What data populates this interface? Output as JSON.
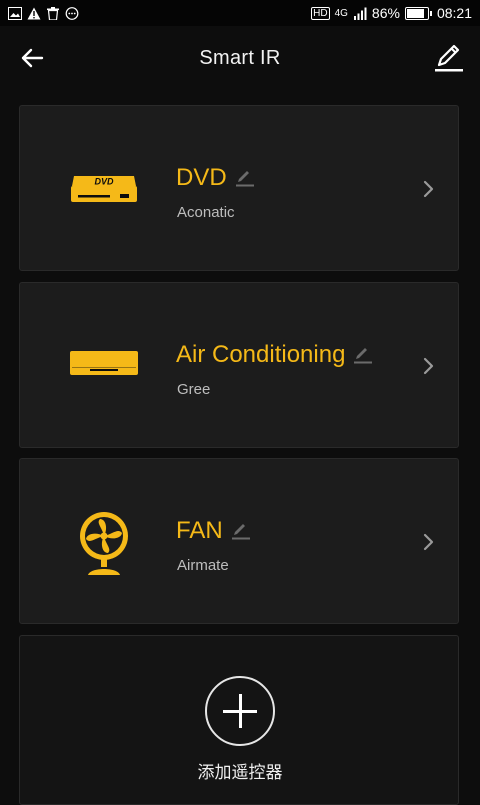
{
  "status_bar": {
    "battery": "86%",
    "time": "08:21",
    "network": "4G",
    "hd": "HD",
    "battery_level": 0.86
  },
  "header": {
    "title": "Smart IR",
    "back_icon": "arrow-left-icon",
    "edit_icon": "pencil-icon"
  },
  "devices": [
    {
      "name": "DVD",
      "brand": "Aconatic",
      "icon": "dvd-player-icon"
    },
    {
      "name": "Air Conditioning",
      "brand": "Gree",
      "icon": "air-conditioner-icon"
    },
    {
      "name": "FAN",
      "brand": "Airmate",
      "icon": "fan-icon"
    }
  ],
  "add_remote": {
    "label": "添加遥控器",
    "icon": "plus-icon"
  },
  "colors": {
    "accent": "#f5b918",
    "background": "#0d0d0d",
    "card": "#1c1c1c"
  }
}
